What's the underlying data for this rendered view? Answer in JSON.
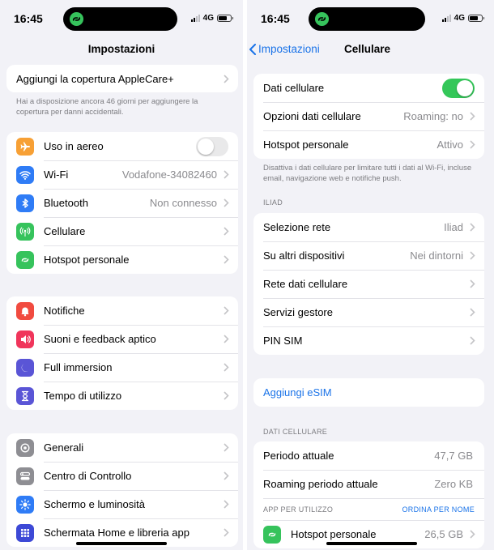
{
  "left": {
    "status": {
      "time": "16:45",
      "network": "4G"
    },
    "nav_title": "Impostazioni",
    "applecare": {
      "label": "Aggiungi la copertura AppleCare+",
      "note": "Hai a disposizione ancora 46 giorni per aggiungere la copertura per danni accidentali."
    },
    "group1": [
      {
        "icon": "airplane-icon",
        "color": "#f7a035",
        "label": "Uso in aereo",
        "toggle": false
      },
      {
        "icon": "wifi-icon",
        "color": "#2f7cf6",
        "label": "Wi-Fi",
        "value": "Vodafone-34082460"
      },
      {
        "icon": "bluetooth-icon",
        "color": "#2f7cf6",
        "label": "Bluetooth",
        "value": "Non connesso"
      },
      {
        "icon": "cellular-icon",
        "color": "#36c35c",
        "label": "Cellulare",
        "value": ""
      },
      {
        "icon": "hotspot-icon",
        "color": "#36c35c",
        "label": "Hotspot personale",
        "value": ""
      }
    ],
    "group2": [
      {
        "icon": "bell-icon",
        "color": "#f14b40",
        "label": "Notifiche"
      },
      {
        "icon": "speaker-icon",
        "color": "#f0355b",
        "label": "Suoni e feedback aptico"
      },
      {
        "icon": "moon-icon",
        "color": "#5a55d6",
        "label": "Full immersion"
      },
      {
        "icon": "hourglass-icon",
        "color": "#5a55d6",
        "label": "Tempo di utilizzo"
      }
    ],
    "group3": [
      {
        "icon": "gear-icon",
        "color": "#8e8e93",
        "label": "Generali"
      },
      {
        "icon": "switches-icon",
        "color": "#8e8e93",
        "label": "Centro di Controllo"
      },
      {
        "icon": "sun-icon",
        "color": "#2f7cf6",
        "label": "Schermo e luminosità"
      },
      {
        "icon": "grid-icon",
        "color": "#3d49d6",
        "label": "Schermata Home e libreria app"
      }
    ]
  },
  "right": {
    "status": {
      "time": "16:45",
      "network": "4G"
    },
    "back_label": "Impostazioni",
    "nav_title": "Cellulare",
    "group1": [
      {
        "label": "Dati cellulare",
        "toggle": true
      },
      {
        "label": "Opzioni dati cellulare",
        "value": "Roaming: no"
      },
      {
        "label": "Hotspot personale",
        "value": "Attivo"
      }
    ],
    "note": "Disattiva i dati cellulare per limitare tutti i dati al Wi-Fi, incluse email, navigazione web e notifiche push.",
    "iliad_header": "ILIAD",
    "iliad_rows": [
      {
        "label": "Selezione rete",
        "value": "Iliad"
      },
      {
        "label": "Su altri dispositivi",
        "value": "Nei dintorni"
      },
      {
        "label": "Rete dati cellulare",
        "value": ""
      },
      {
        "label": "Servizi gestore",
        "value": ""
      },
      {
        "label": "PIN SIM",
        "value": ""
      }
    ],
    "esim_label": "Aggiungi eSIM",
    "data_header": "DATI CELLULARE",
    "data_rows": [
      {
        "label": "Periodo attuale",
        "value": "47,7 GB"
      },
      {
        "label": "Roaming periodo attuale",
        "value": "Zero KB"
      }
    ],
    "app_header": "APP PER UTILIZZO",
    "app_sort": "ORDINA PER NOME",
    "app_rows": [
      {
        "icon": "hotspot-icon",
        "color": "#36c35c",
        "label": "Hotspot personale",
        "value": "26,5 GB"
      }
    ]
  }
}
